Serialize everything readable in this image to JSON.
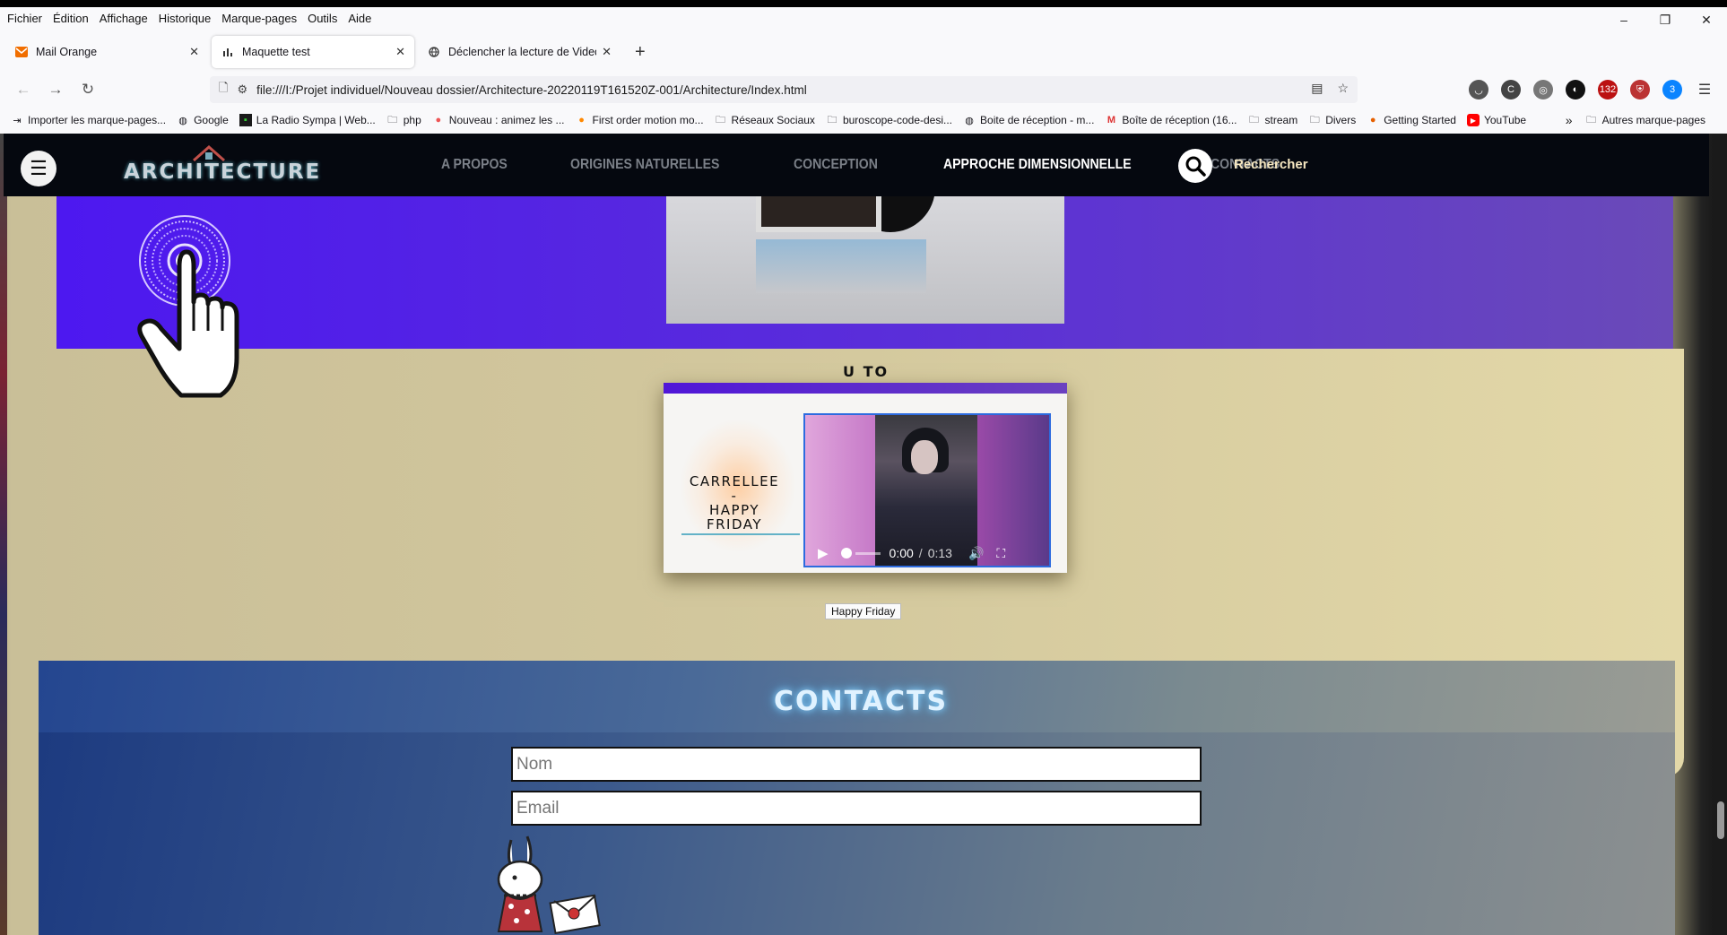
{
  "browser": {
    "menu": [
      "Fichier",
      "Édition",
      "Affichage",
      "Historique",
      "Marque-pages",
      "Outils",
      "Aide"
    ],
    "window_controls": [
      "–",
      "❐",
      "✕"
    ],
    "tabs": [
      {
        "label": "Mail Orange",
        "icon": "mail-icon",
        "active": false
      },
      {
        "label": "Maquette test",
        "icon": "chart-icon",
        "active": true
      },
      {
        "label": "Déclencher la lecture de Video au",
        "icon": "globe-icon",
        "active": false
      }
    ],
    "new_tab": "+",
    "url": "file:///I:/Projet individuel/Nouveau dossier/Architecture-20220119T161520Z-001/Architecture/Index.html",
    "extension_badges": {
      "ext1": "132",
      "ext2": "3"
    },
    "bookmarks": [
      "Importer les marque-pages...",
      "Google",
      "La Radio Sympa | Web...",
      "php",
      "Nouveau : animez les ...",
      "First order motion mo...",
      "Réseaux Sociaux",
      "buroscope-code-desi...",
      "Boite de réception - m...",
      "Boîte de réception (16...",
      "stream",
      "Divers",
      "Getting Started",
      "YouTube"
    ],
    "bookmarks_overflow": "»",
    "other_bookmarks": "Autres marque-pages"
  },
  "site": {
    "logo": "ARCHITECTURE",
    "nav": [
      {
        "label": "A PROPOS",
        "active": false
      },
      {
        "label": "ORIGINES NATURELLES",
        "active": false
      },
      {
        "label": "CONCEPTION",
        "active": false
      },
      {
        "label": "APPROCHE DIMENSIONNELLE",
        "active": true
      },
      {
        "label": "CONTACTS",
        "active": false
      }
    ],
    "search_label": "Rechercher",
    "section_title": "U TO",
    "video_card": {
      "song_line1": "CARRELLEE",
      "song_line2": "-",
      "song_line3": "HAPPY",
      "song_line4": "FRIDAY",
      "time_current": "0:00",
      "time_sep": "/",
      "time_duration": "0:13",
      "tooltip": "Happy Friday",
      "progress": 0
    },
    "contacts": {
      "title": "CONTACTS",
      "name_placeholder": "Nom",
      "email_placeholder": "Email"
    }
  },
  "colors": {
    "nav_bg": "#05080f",
    "purple_band": "#4d18f0",
    "sand": "#d2c79c",
    "contact_blue": "#1c3a80",
    "video_border": "#2d6bdf"
  }
}
